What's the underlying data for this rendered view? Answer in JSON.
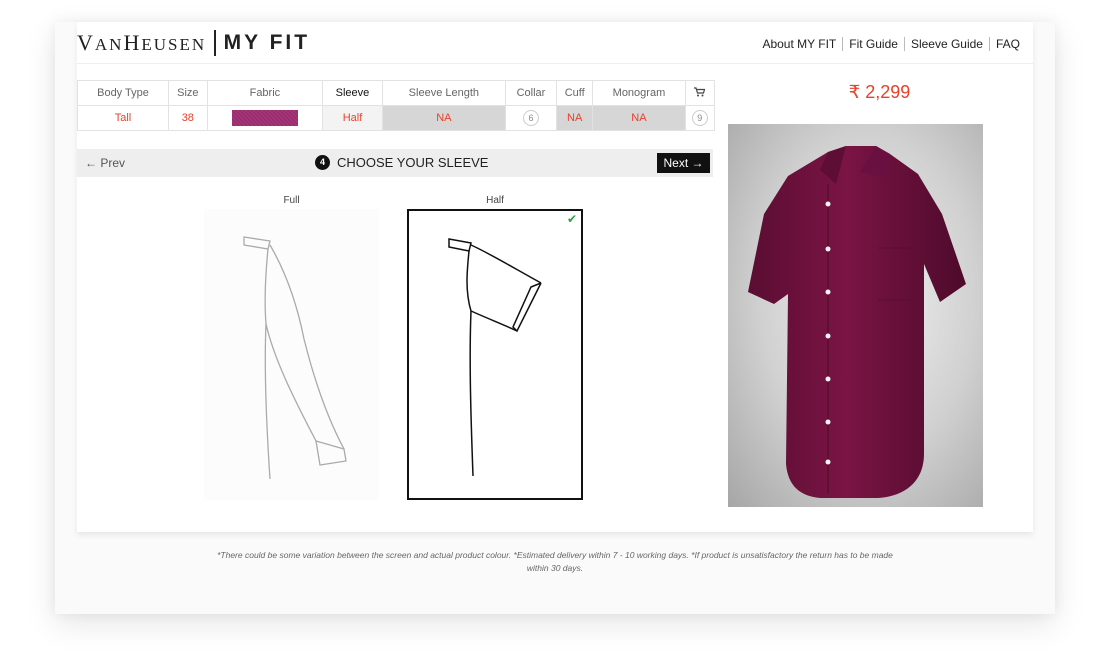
{
  "brand": {
    "name_a": "V",
    "name_b": "AN",
    "name_c": "H",
    "name_d": "EUSEN",
    "product": "MY FIT"
  },
  "nav": [
    {
      "label": "About MY FIT"
    },
    {
      "label": "Fit Guide"
    },
    {
      "label": "Sleeve Guide"
    },
    {
      "label": "FAQ"
    }
  ],
  "options": {
    "headers": [
      "Body Type",
      "Size",
      "Fabric",
      "Sleeve",
      "Sleeve Length",
      "Collar",
      "Cuff",
      "Monogram"
    ],
    "values": [
      "Tall",
      "38",
      "",
      "Half",
      "NA",
      "6",
      "NA",
      "NA"
    ],
    "cart_step": "9",
    "fabric_color": "#9b2a6e"
  },
  "price": "₹ 2,299",
  "step": {
    "prev_label": "← Prev",
    "number": "4",
    "title": "CHOOSE YOUR SLEEVE",
    "next_label": "Next"
  },
  "sleeves": [
    {
      "label": "Full",
      "selected": false
    },
    {
      "label": "Half",
      "selected": true
    }
  ],
  "preview": {
    "shirt_color": "#7a1444"
  },
  "footer": {
    "line1": "*There could be some variation between the screen and actual product colour. *Estimated delivery within 7 - 10 working days. *If product is unsatisfactory the return has to be made",
    "line2": "within 30 days."
  }
}
